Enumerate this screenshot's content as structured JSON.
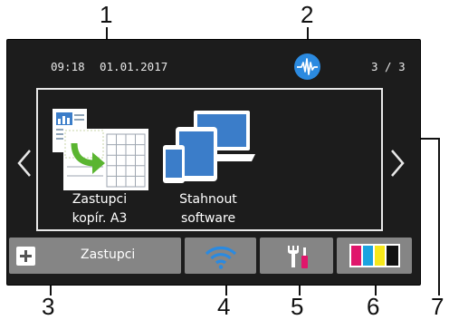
{
  "callouts": {
    "n1": "1",
    "n2": "2",
    "n3": "3",
    "n4": "4",
    "n5": "5",
    "n6": "6",
    "n7": "7"
  },
  "status_bar": {
    "time": "09:18",
    "date": "01.01.2017",
    "page_indicator": "3 / 3",
    "status_icon": "wifi-direct-pulse-icon"
  },
  "apps": [
    {
      "line1": "Zastupci",
      "line2": "kopír. A3",
      "icon": "a3-copy-icon"
    },
    {
      "line1": "Stahnout",
      "line2": "software",
      "icon": "devices-icon"
    }
  ],
  "bottom_bar": {
    "shortcut_label": "Zastupci",
    "wifi_icon": "wifi-icon",
    "tools_icon": "tools-icon",
    "ink_icon": "ink-icon"
  },
  "colors": {
    "screen_bg": "#1c1c1c",
    "button_bg": "#858585",
    "wifi_blue": "#2b8ae0",
    "ink_magenta": "#e0166b",
    "ink_cyan": "#1ba3e0",
    "ink_yellow": "#f6e71a",
    "ink_black": "#111111"
  }
}
